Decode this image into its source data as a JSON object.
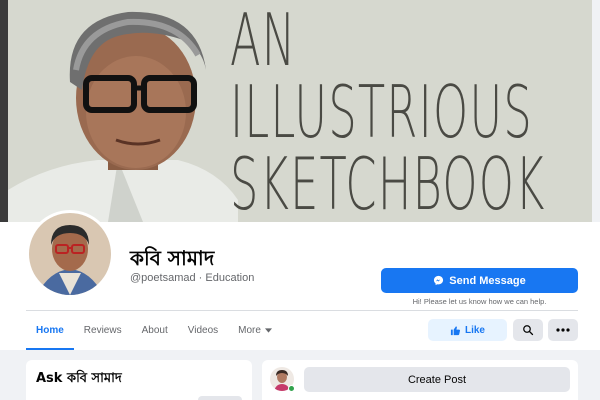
{
  "cover": {
    "lines": [
      "AN",
      "ILLUSTRIOUS",
      "SKETCHBOOK"
    ]
  },
  "page": {
    "name": "কবি সামাদ",
    "handle": "@poetsamad",
    "separator": "·",
    "category": "Education"
  },
  "actions": {
    "send_message": "Send Message",
    "help_text": "Hi! Please let us know how we can help.",
    "like": "Like"
  },
  "tabs": [
    {
      "label": "Home",
      "active": true
    },
    {
      "label": "Reviews"
    },
    {
      "label": "About"
    },
    {
      "label": "Videos"
    },
    {
      "label": "More"
    }
  ],
  "ask": {
    "title": "Ask কবি সামাদ"
  },
  "composer": {
    "create_post": "Create Post"
  },
  "colors": {
    "accent": "#1877f2",
    "like_bg": "#e7f3ff",
    "online": "#31a24c"
  },
  "icons": [
    "messenger-icon",
    "thumbs-up-icon",
    "search-icon",
    "ellipsis-icon",
    "caret-down-icon"
  ]
}
